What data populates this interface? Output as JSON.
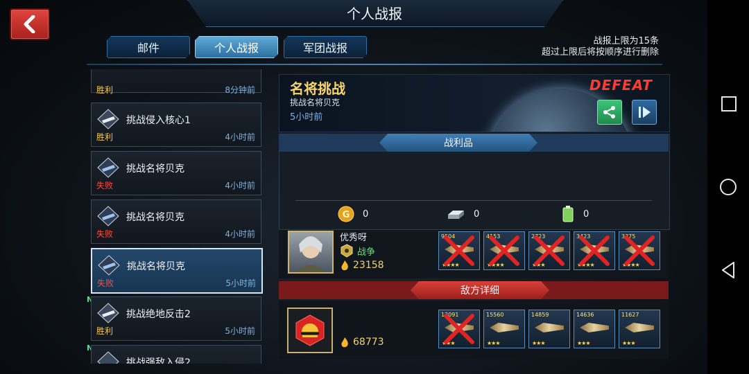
{
  "header": {
    "title": "个人战报",
    "back_icon": "back-arrow-icon"
  },
  "tabs": [
    {
      "label": "邮件",
      "active": false
    },
    {
      "label": "个人战报",
      "active": true
    },
    {
      "label": "军团战报",
      "active": false
    }
  ],
  "notice": {
    "line1": "战报上限为15条",
    "line2": "超过上限后将按顺序进行删除"
  },
  "reports": [
    {
      "name": "",
      "status": "胜利",
      "result": "win",
      "time": "8分钟前"
    },
    {
      "name": "挑战侵入核心1",
      "status": "胜利",
      "result": "win",
      "time": "4小时前"
    },
    {
      "name": "挑战名将贝克",
      "status": "失败",
      "result": "lose",
      "time": "4小时前"
    },
    {
      "name": "挑战名将贝克",
      "status": "失败",
      "result": "lose",
      "time": "4小时前"
    },
    {
      "name": "挑战名将贝克",
      "status": "失败",
      "result": "lose",
      "time": "5小时前",
      "selected": true
    },
    {
      "name": "挑战绝地反击2",
      "status": "胜利",
      "result": "win",
      "time": "5小时前",
      "tag": "NEW"
    },
    {
      "name": "挑战强敌入侵2",
      "status": "",
      "result": "",
      "time": "",
      "tag": "NEW"
    }
  ],
  "detail": {
    "title": "名将挑战",
    "subtitle": "挑战名将贝克",
    "time": "5小时前",
    "result": "DEFEAT",
    "share_icon": "share-icon",
    "replay_icon": "replay-icon"
  },
  "loot": {
    "label": "战利品",
    "resources": [
      {
        "icon": "gold-coin-icon",
        "value": "0"
      },
      {
        "icon": "metal-ingot-icon",
        "value": "0"
      },
      {
        "icon": "energy-battery-icon",
        "value": "0"
      }
    ]
  },
  "player": {
    "name": "优秀呀",
    "faction": "战争",
    "power": "23158",
    "fleet": [
      {
        "power": "9504",
        "stars": "★★★★",
        "destroyed": true
      },
      {
        "power": "4153",
        "stars": "★★★★",
        "destroyed": true
      },
      {
        "power": "2723",
        "stars": "★★★",
        "destroyed": true
      },
      {
        "power": "3423",
        "stars": "★★★★",
        "destroyed": true
      },
      {
        "power": "3375",
        "stars": "★★★★",
        "destroyed": true
      }
    ]
  },
  "enemy": {
    "label": "敌方详细",
    "power": "68773",
    "fleet": [
      {
        "power": "12091",
        "stars": "★★★",
        "destroyed": true
      },
      {
        "power": "15560",
        "stars": "★★★",
        "destroyed": false
      },
      {
        "power": "14859",
        "stars": "★★★",
        "destroyed": false
      },
      {
        "power": "14636",
        "stars": "★★★",
        "destroyed": false
      },
      {
        "power": "11627",
        "stars": "★★★",
        "destroyed": false
      }
    ]
  },
  "colors": {
    "win": "#f3c74c",
    "lose": "#ff4a3a",
    "accent": "#2f6fa3",
    "defeat": "#ff3b2f"
  },
  "system_nav": {
    "recents_icon": "recents-square-icon",
    "home_icon": "home-circle-icon",
    "back_icon": "back-triangle-icon"
  }
}
